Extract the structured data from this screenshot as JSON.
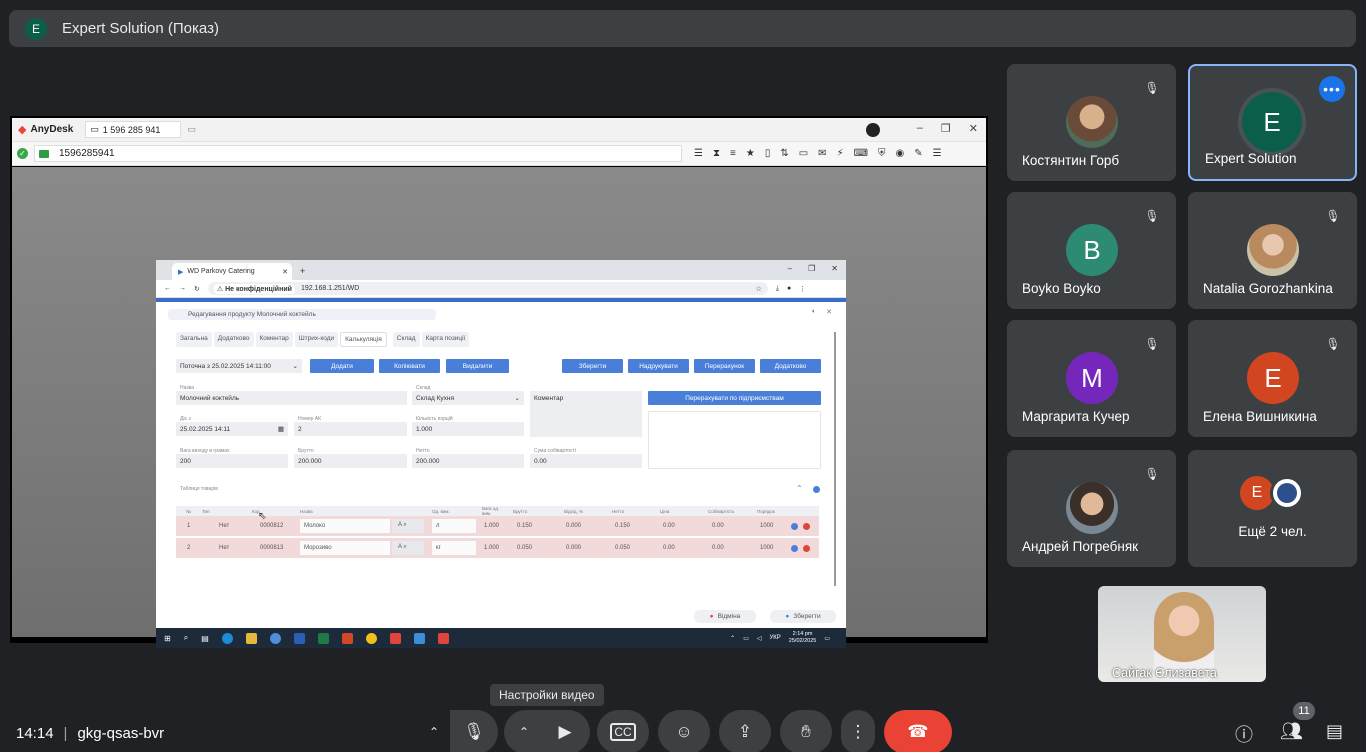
{
  "presenter": {
    "initial": "E",
    "title": "Expert Solution (Показ)"
  },
  "anydesk": {
    "app_name": "AnyDesk",
    "tab_label": "1 596 285 941",
    "address": "1596285941"
  },
  "remote_browser": {
    "tab_title": "WD Parkovy Catering",
    "not_secure": "Не конфіденційний",
    "url": "192.168.1.251/WD",
    "dialog_title": "Редагування продукту Молочний коктейль",
    "tabs": [
      "Загальна",
      "Додатково",
      "Коментар",
      "Штрих-коди",
      "Калькуляція",
      "Склад",
      "Карта позиції"
    ],
    "current_version": "Поточна з 25.02.2025 14:11:00",
    "buttons": {
      "add": "Додати",
      "copy": "Копіювати",
      "delete": "Видалити",
      "save": "Зберегти",
      "print": "Надрукувати",
      "recalc": "Перерахунок",
      "extra": "Додатково",
      "recalc_by_company": "Перерахувати по підприємствам"
    },
    "labels": {
      "name": "Назва",
      "warehouse": "Склад",
      "valid_from": "Діє з",
      "number": "Номер АК",
      "portions": "Кількість порцій",
      "output_weight": "Вага виходу в грамах",
      "gross": "Брутто",
      "net": "Нетто",
      "cost_total": "Сума собівартості",
      "goods_table": "Таблиця товарів"
    },
    "values": {
      "name": "Молочний коктейль",
      "warehouse": "Склад Кухня",
      "comment_placeholder": "Коментар",
      "valid_from": "25.02.2025 14:11",
      "number": "2",
      "portions": "1.000",
      "output_weight": "200",
      "gross": "200.000",
      "net": "200.000",
      "cost_total": "0.00"
    },
    "table_headers": [
      "№",
      "Тип",
      "Код",
      "Назва",
      "Од. вим.",
      "Вага од. вим.",
      "Брутто",
      "Відхід, %",
      "Нетто",
      "Ціна",
      "Собівартість",
      "Порядок"
    ],
    "rows": [
      {
        "n": "1",
        "type": "Нет",
        "code": "0000812",
        "name": "Молоко",
        "unit": "л",
        "unit_weight": "1.000",
        "gross": "0.150",
        "waste": "0.000",
        "net": "0.150",
        "price": "0.00",
        "cost": "0.00",
        "order": "1000"
      },
      {
        "n": "2",
        "type": "Нет",
        "code": "0000813",
        "name": "Морозиво",
        "unit": "кг",
        "unit_weight": "1.000",
        "gross": "0.050",
        "waste": "0.000",
        "net": "0.050",
        "price": "0.00",
        "cost": "0.00",
        "order": "1000"
      }
    ],
    "footer": {
      "cancel": "Відміна",
      "save": "Зберегти"
    },
    "taskbar": {
      "lang": "УКР",
      "time": "2:14 pm",
      "date": "25/02/2025"
    }
  },
  "participants": [
    {
      "name": "Костянтин Горб",
      "initial": "",
      "color": "",
      "photo": true,
      "muted": true
    },
    {
      "name": "Expert Solution",
      "initial": "E",
      "color": "#0b5e4a",
      "photo": false,
      "muted": false,
      "speaking": true
    },
    {
      "name": "Boyko Boyko",
      "initial": "B",
      "color": "#2e8b73",
      "photo": false,
      "muted": true
    },
    {
      "name": "Natalia Gorozhankina",
      "initial": "",
      "color": "",
      "photo": true,
      "muted": true
    },
    {
      "name": "Маргарита Кучер",
      "initial": "M",
      "color": "#7627bb",
      "photo": false,
      "muted": true
    },
    {
      "name": "Елена Вишникина",
      "initial": "E",
      "color": "#d14621",
      "photo": false,
      "muted": true
    },
    {
      "name": "Андрей Погребняк",
      "initial": "",
      "color": "",
      "photo": true,
      "muted": true
    },
    {
      "name": "Ещё 2 чел.",
      "initial": "E",
      "color": "#d14621",
      "photo": false,
      "muted": false
    }
  ],
  "self_view": {
    "name": "Сайгак Єлизавета"
  },
  "tooltip": "Настройки видео",
  "meeting": {
    "time": "14:14",
    "code": "gkg-qsas-bvr"
  },
  "people_count": "11"
}
